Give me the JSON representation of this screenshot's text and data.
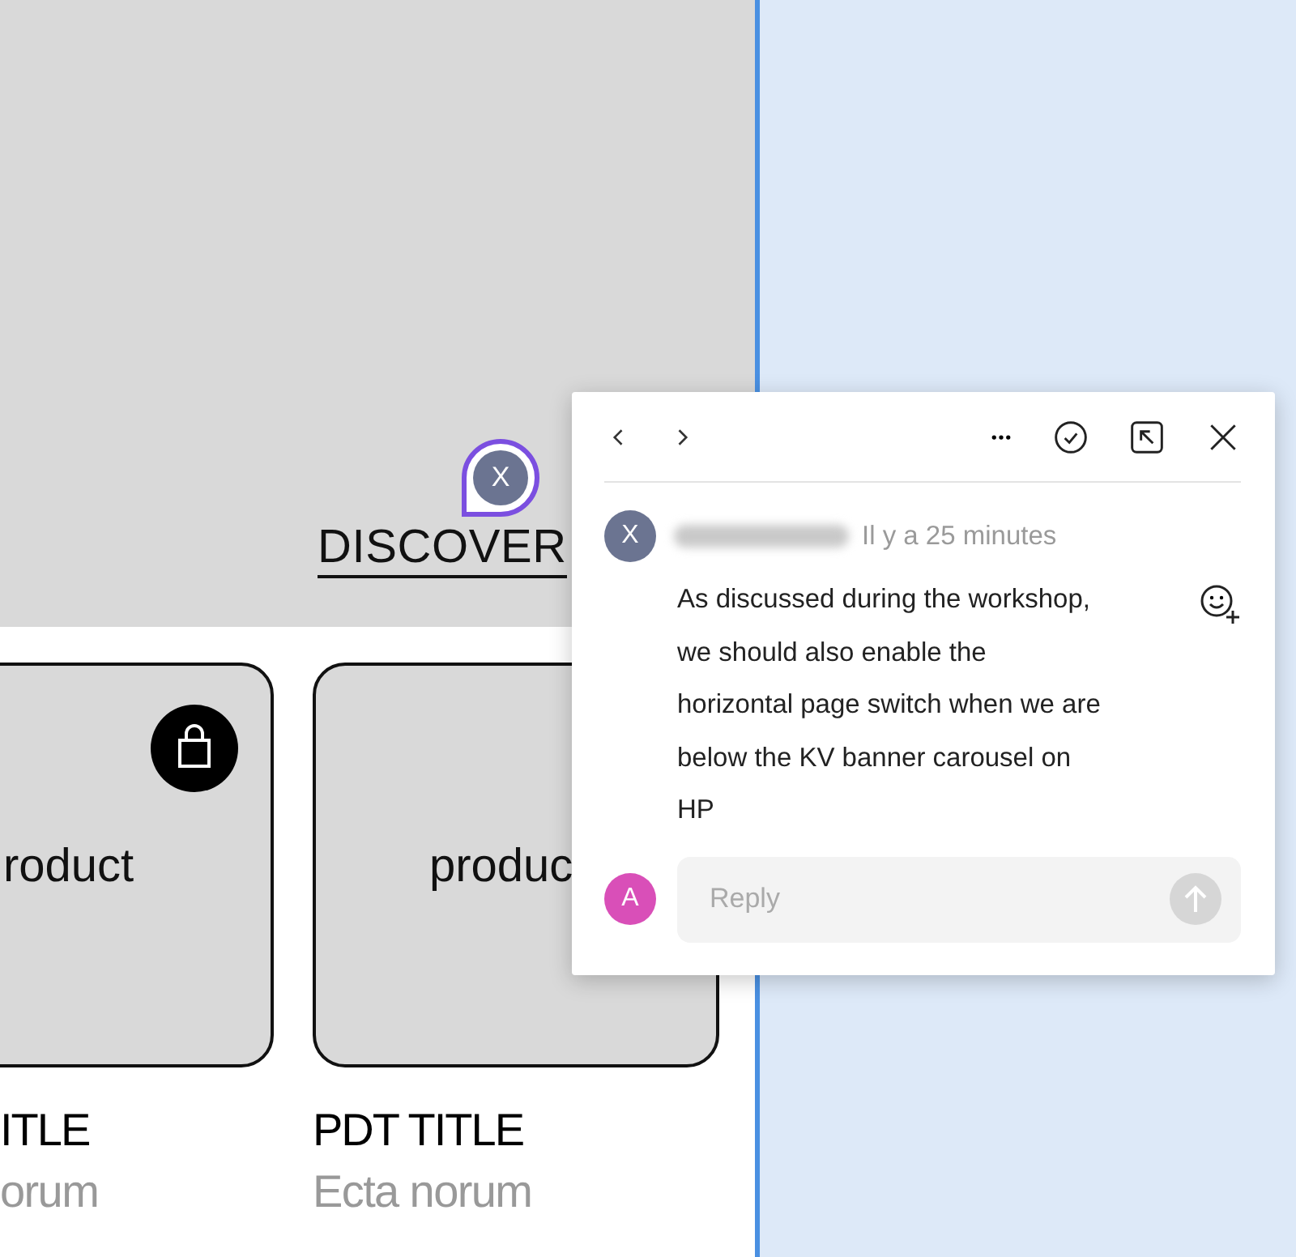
{
  "canvas": {
    "banner": {
      "link": "DISCOVER"
    },
    "pin": {
      "initial": "X"
    },
    "products": [
      {
        "image_label": "roduct",
        "title": "ITLE",
        "subtitle": "orum",
        "cart_button": true
      },
      {
        "image_label": "produc",
        "title": "PDT TITLE",
        "subtitle": "Ecta norum",
        "cart_button": false
      }
    ]
  },
  "comment_popup": {
    "comment": {
      "avatar": "X",
      "time": "Il y a 25 minutes",
      "text": "As discussed during the workshop,\nwe should also enable the\nhorizontal page switch when we are\nbelow the KV banner carousel on\nHP"
    },
    "reply": {
      "avatar": "A",
      "placeholder": "Reply"
    }
  }
}
